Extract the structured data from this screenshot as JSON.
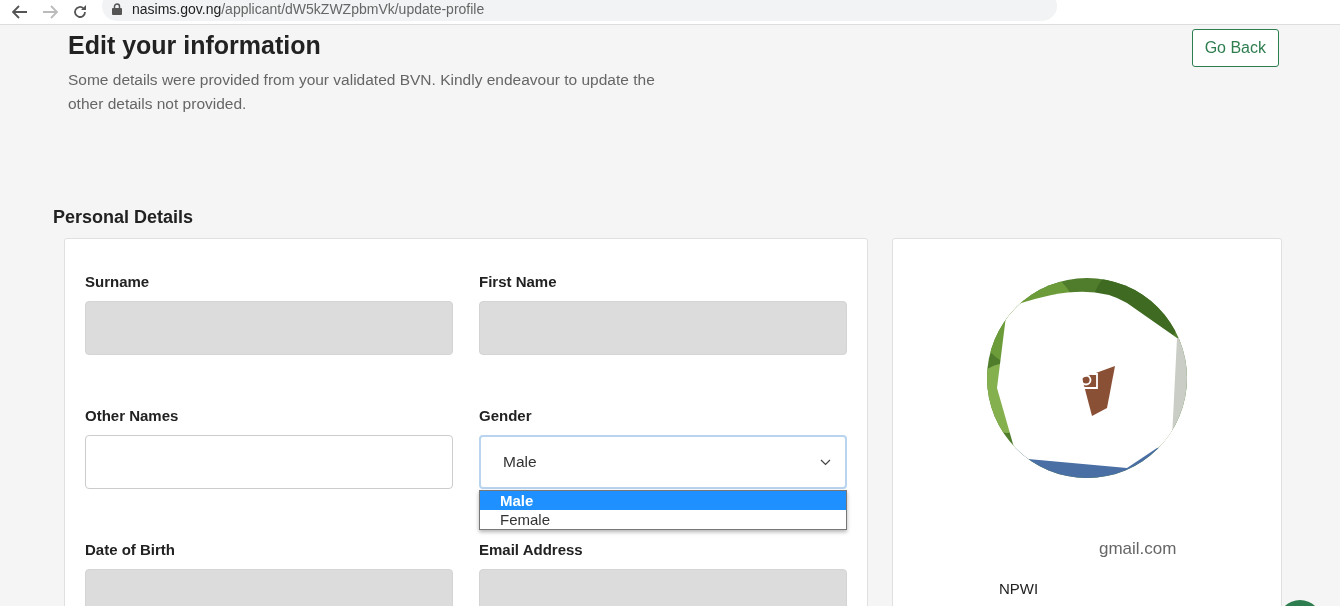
{
  "browser": {
    "url_domain": "nasims.gov.ng",
    "url_path": "/applicant/dW5kZWZpbmVk/update-profile",
    "forward_disabled": true
  },
  "header": {
    "title": "Edit your information",
    "subtitle": "Some details were provided from your validated BVN. Kindly endeavour to update the other details not provided.",
    "back_button": "Go Back"
  },
  "section_title": "Personal Details",
  "fields": [
    {
      "kind": "text",
      "label": "Surname",
      "disabled": true
    },
    {
      "kind": "text",
      "label": "First Name",
      "disabled": true
    },
    {
      "kind": "text",
      "label": "Other Names",
      "disabled": false
    },
    {
      "kind": "select",
      "label": "Gender",
      "value": "Male",
      "expanded": true,
      "options": [
        {
          "label": "Male",
          "selected": true
        },
        {
          "label": "Female",
          "selected": false
        }
      ]
    },
    {
      "kind": "text",
      "label": "Date of Birth",
      "disabled": true
    },
    {
      "kind": "text",
      "label": "Email Address",
      "disabled": true
    }
  ],
  "profile": {
    "email": "gmail.com",
    "code": "NPWI"
  }
}
